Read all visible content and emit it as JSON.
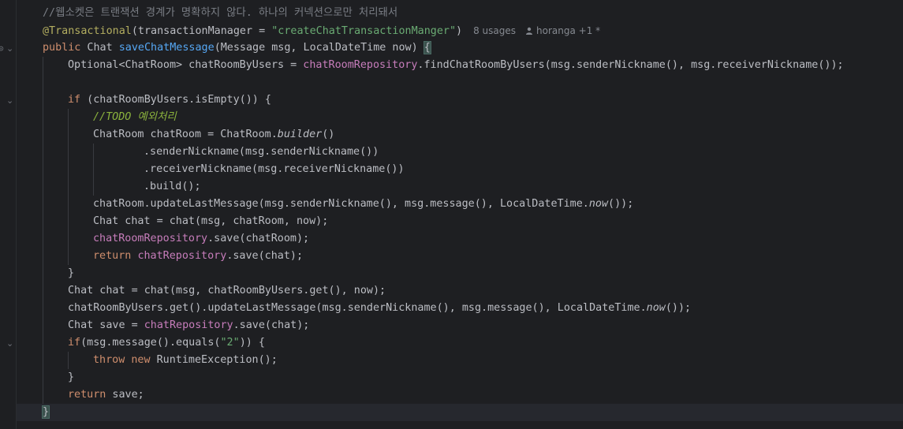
{
  "editor": {
    "lines": {
      "l1": {
        "comment": "//웹소켓은 트랜잭션 경계가 명확하지 않다. 하나의 커넥션으로만 처리돼서"
      },
      "l2": {
        "annotation": "@Transactional",
        "p1": "(transactionManager = ",
        "str": "\"createChatTransactionManger\"",
        "p2": ")",
        "usages": "8 usages",
        "author": "horanga +1 *"
      },
      "l3": {
        "kw": "public",
        "p1": " Chat ",
        "method": "saveChatMessage",
        "p2": "(Message msg, LocalDateTime now) ",
        "brace": "{"
      },
      "l4": {
        "p1": "Optional<ChatRoom> chatRoomByUsers = ",
        "field": "chatRoomRepository",
        "p2": ".findChatRoomByUsers(msg.senderNickname(), msg.receiverNickname());"
      },
      "l6": {
        "kw": "if",
        "p1": " (chatRoomByUsers.isEmpty()) {"
      },
      "l7": {
        "todo": "//TODO 예외처리"
      },
      "l8": {
        "p1": "ChatRoom chatRoom = ChatRoom.",
        "italic": "builder",
        "p2": "()"
      },
      "l9": {
        "p1": ".senderNickname(msg.senderNickname())"
      },
      "l10": {
        "p1": ".receiverNickname(msg.receiverNickname())"
      },
      "l11": {
        "p1": ".build();"
      },
      "l12": {
        "p1": "chatRoom.updateLastMessage(msg.senderNickname(), msg.message(), LocalDateTime.",
        "italic": "now",
        "p2": "());"
      },
      "l13": {
        "p1": "Chat chat = chat(msg, chatRoom, now);"
      },
      "l14": {
        "field": "chatRoomRepository",
        "p1": ".save(chatRoom);"
      },
      "l15": {
        "kw": "return",
        "p1": " ",
        "field": "chatRepository",
        "p2": ".save(chat);"
      },
      "l16": {
        "p1": "}"
      },
      "l17": {
        "p1": "Chat chat = chat(msg, chatRoomByUsers.get(), now);"
      },
      "l18": {
        "p1": "chatRoomByUsers.get().updateLastMessage(msg.senderNickname(), msg.message(), LocalDateTime.",
        "italic": "now",
        "p2": "());"
      },
      "l19": {
        "p1": "Chat save = ",
        "field": "chatRepository",
        "p2": ".save(chat);"
      },
      "l20": {
        "kw": "if",
        "p1": "(msg.message().equals(",
        "str": "\"2\"",
        "p2": ")) {"
      },
      "l21": {
        "kw1": "throw",
        "p1": " ",
        "kw2": "new",
        "p2": " RuntimeException();"
      },
      "l22": {
        "p1": "}"
      },
      "l23": {
        "kw": "return",
        "p1": " save;"
      },
      "l24": {
        "brace": "}"
      }
    },
    "colors": {
      "background": "#1e1f22",
      "keyword": "#cf8e6d",
      "annotation": "#b3ae60",
      "method": "#56a8f5",
      "field": "#c77dbb",
      "string": "#6aab73",
      "comment": "#7a7e85",
      "todo": "#8bb33d"
    },
    "icons": {
      "fold": "chevron-down-icon",
      "bulb": "lightbulb-icon",
      "person": "person-icon"
    }
  }
}
